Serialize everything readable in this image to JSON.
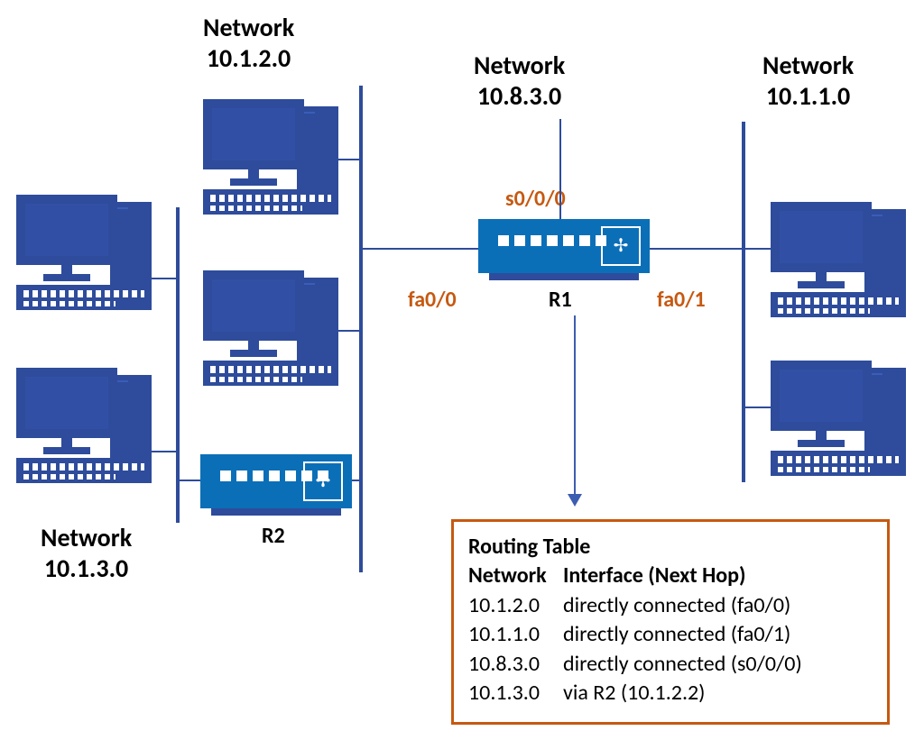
{
  "networks": {
    "n1": {
      "title": "Network",
      "ip": "10.1.2.0"
    },
    "n2": {
      "title": "Network",
      "ip": "10.8.3.0"
    },
    "n3": {
      "title": "Network",
      "ip": "10.1.1.0"
    },
    "n4": {
      "title": "Network",
      "ip": "10.1.3.0"
    }
  },
  "routers": {
    "r1": {
      "name": "R1",
      "interfaces": {
        "serial": "s0/0/0",
        "left": "fa0/0",
        "right": "fa0/1"
      }
    },
    "r2": {
      "name": "R2"
    }
  },
  "routing_table": {
    "title": "Routing Table",
    "columns": {
      "c1": "Network",
      "c2": "Interface (Next Hop)"
    },
    "rows": [
      {
        "network": "10.1.2.0",
        "next": "directly connected (fa0/0)"
      },
      {
        "network": "10.1.1.0",
        "next": "directly connected (fa0/1)"
      },
      {
        "network": "10.8.3.0",
        "next": "directly connected (s0/0/0)"
      },
      {
        "network": "10.1.3.0",
        "next": "via R2 (10.1.2.2)"
      }
    ]
  }
}
